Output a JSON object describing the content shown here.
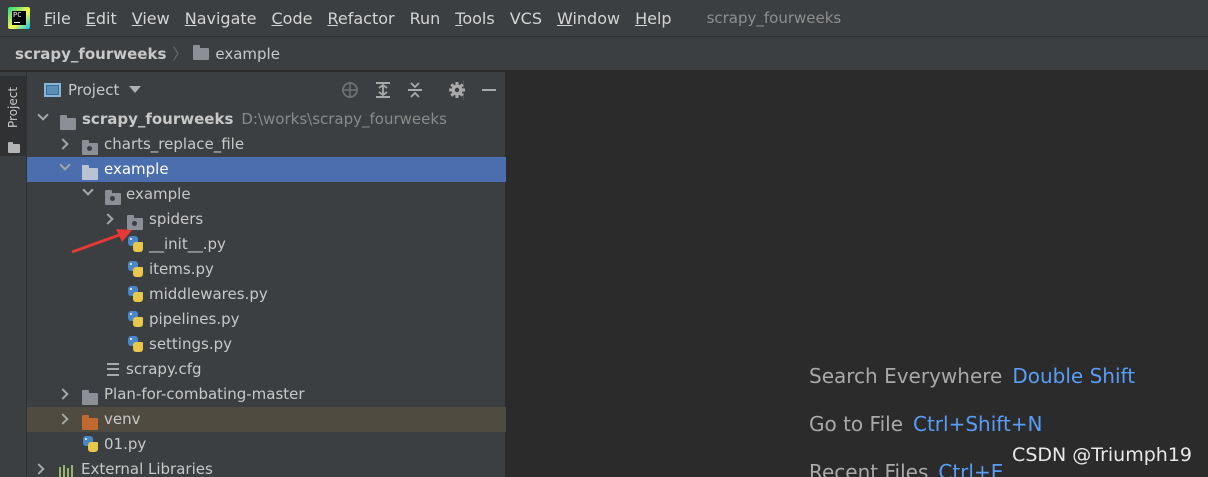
{
  "menubar": {
    "items": [
      {
        "mnemonic": "F",
        "rest": "ile"
      },
      {
        "mnemonic": "E",
        "rest": "dit"
      },
      {
        "mnemonic": "V",
        "rest": "iew"
      },
      {
        "mnemonic": "N",
        "rest": "avigate"
      },
      {
        "mnemonic": "C",
        "rest": "ode"
      },
      {
        "mnemonic": "R",
        "rest": "efactor"
      },
      {
        "mnemonic": "",
        "rest": "Run"
      },
      {
        "mnemonic": "T",
        "rest": "ools"
      },
      {
        "mnemonic": "",
        "rest": "VCS"
      },
      {
        "mnemonic": "W",
        "rest": "indow"
      },
      {
        "mnemonic": "H",
        "rest": "elp"
      }
    ],
    "window_title": "scrapy_fourweeks"
  },
  "breadcrumb": {
    "root": "scrapy_fourweeks",
    "current": "example"
  },
  "side_strip": {
    "tab_label": "Project"
  },
  "project_panel": {
    "title": "Project",
    "tree": {
      "root_name": "scrapy_fourweeks",
      "root_path": "D:\\works\\scrapy_fourweeks",
      "charts_replace_file": "charts_replace_file",
      "example_outer": "example",
      "example_inner": "example",
      "spiders": "spiders",
      "init_py": "__init__.py",
      "items_py": "items.py",
      "middlewares_py": "middlewares.py",
      "pipelines_py": "pipelines.py",
      "settings_py": "settings.py",
      "scrapy_cfg": "scrapy.cfg",
      "plan": "Plan-for-combating-master",
      "venv": "venv",
      "file_01": "01.py",
      "external_libraries": "External Libraries"
    }
  },
  "editor": {
    "hints": [
      {
        "label": "Search Everywhere",
        "key": "Double Shift"
      },
      {
        "label": "Go to File",
        "key": "Ctrl+Shift+N"
      },
      {
        "label": "Recent Files",
        "key": "Ctrl+E"
      }
    ]
  },
  "watermark": "CSDN @Triumph19",
  "colors": {
    "selection": "#4b6eaf",
    "link_key": "#589df6",
    "venv_folder": "#c06a2f",
    "annotation_arrow": "#e53935"
  }
}
